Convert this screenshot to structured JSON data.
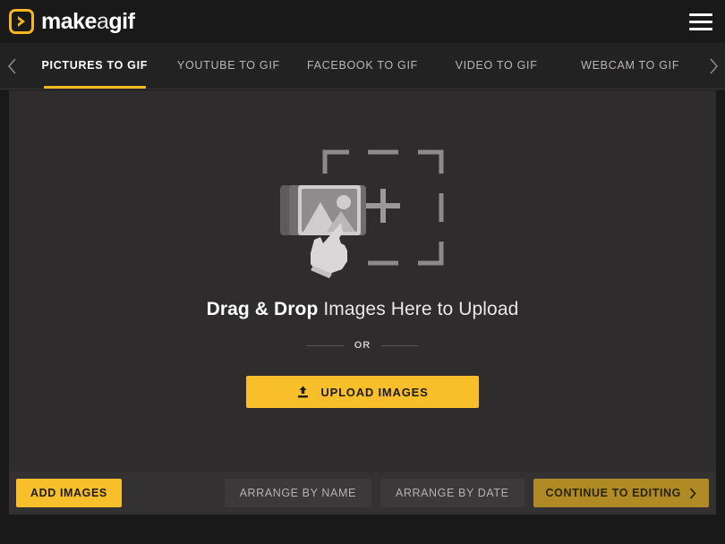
{
  "header": {
    "logo": {
      "icon": "play-chevron-icon",
      "text_make": "make",
      "text_a": "a",
      "text_gif": "gif"
    },
    "menu_icon": "hamburger-menu-icon"
  },
  "tabs": {
    "prev_icon": "chevron-left-icon",
    "next_icon": "chevron-right-icon",
    "items": [
      {
        "label": "PICTURES TO GIF",
        "active": true
      },
      {
        "label": "YOUTUBE TO GIF",
        "active": false
      },
      {
        "label": "FACEBOOK TO GIF",
        "active": false
      },
      {
        "label": "VIDEO TO GIF",
        "active": false
      },
      {
        "label": "WEBCAM TO GIF",
        "active": false
      }
    ]
  },
  "dropzone": {
    "illustration_icon": "image-upload-pointer-icon",
    "headline_strong": "Drag & Drop",
    "headline_rest": " Images Here to Upload",
    "divider_label": "OR",
    "upload_button": {
      "icon": "upload-icon",
      "label": "UPLOAD IMAGES"
    }
  },
  "toolbar": {
    "add_images_label": "ADD IMAGES",
    "arrange_by_name_label": "ARRANGE BY NAME",
    "arrange_by_date_label": "ARRANGE BY DATE",
    "continue_label": "CONTINUE TO EDITING",
    "continue_icon": "chevron-right-icon"
  },
  "colors": {
    "brand_yellow": "#f9bf2b",
    "accent_underline": "#f5b820",
    "continue_disabled": "#b08a24",
    "header_bg": "#1a1919",
    "tabbar_bg": "#232222",
    "stage_bg": "#2e2c2c",
    "toolbar_bg": "#333131"
  }
}
